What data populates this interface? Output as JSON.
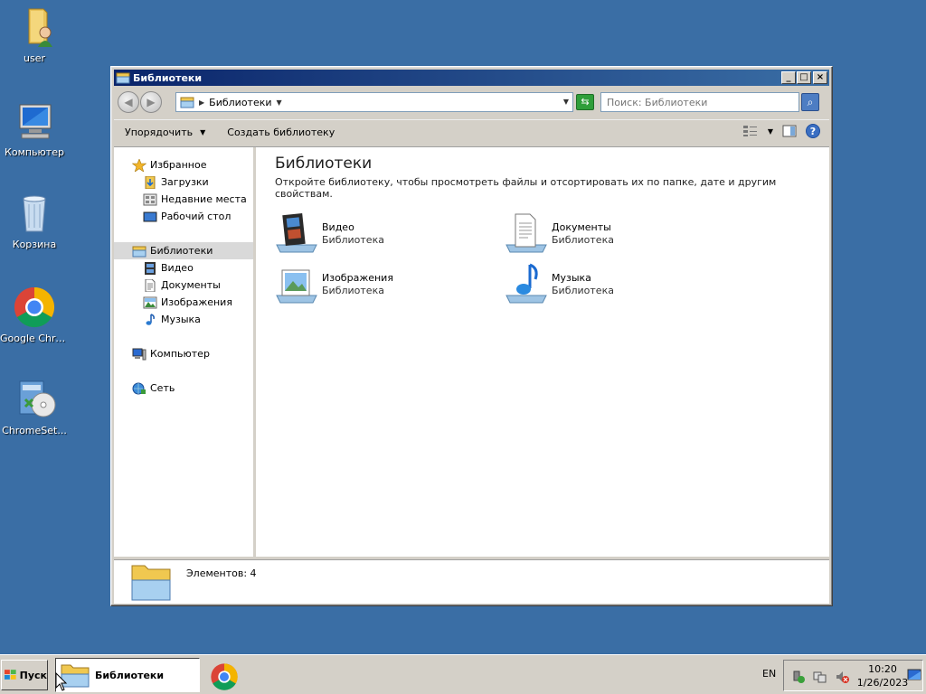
{
  "desktop": {
    "icons": [
      {
        "label": "user"
      },
      {
        "label": "Компьютер"
      },
      {
        "label": "Корзина"
      },
      {
        "label": "Google Chrome"
      },
      {
        "label": "ChromeSet..."
      }
    ]
  },
  "window": {
    "title": "Библиотеки",
    "controls": {
      "minimize": "_",
      "maximize": "□",
      "close": "×"
    },
    "address": {
      "crumb": "Библиотеки"
    },
    "search": {
      "placeholder": "Поиск: Библиотеки"
    },
    "toolbar": {
      "organize": "Упорядочить",
      "create_library": "Создать библиотеку",
      "help": "?"
    },
    "nav": {
      "favorites": "Избранное",
      "favorites_items": [
        "Загрузки",
        "Недавние места",
        "Рабочий стол"
      ],
      "libraries": "Библиотеки",
      "libraries_items": [
        "Видео",
        "Документы",
        "Изображения",
        "Музыка"
      ],
      "computer": "Компьютер",
      "network": "Сеть"
    },
    "main": {
      "heading": "Библиотеки",
      "description": "Откройте библиотеку, чтобы просмотреть файлы и отсортировать их по папке, дате и другим свойствам.",
      "libraries": [
        {
          "name": "Видео",
          "type": "Библиотека"
        },
        {
          "name": "Документы",
          "type": "Библиотека"
        },
        {
          "name": "Изображения",
          "type": "Библиотека"
        },
        {
          "name": "Музыка",
          "type": "Библиотека"
        }
      ]
    },
    "status": {
      "text": "Элементов: 4"
    }
  },
  "taskbar": {
    "start": "Пуск",
    "active_task": "Библиотеки",
    "language": "EN",
    "time": "10:20",
    "date": "1/26/2023"
  },
  "colors": {
    "desktop": "#3a6ea5",
    "titlebar": "#0a246a",
    "chrome": "#d4d0c8"
  }
}
